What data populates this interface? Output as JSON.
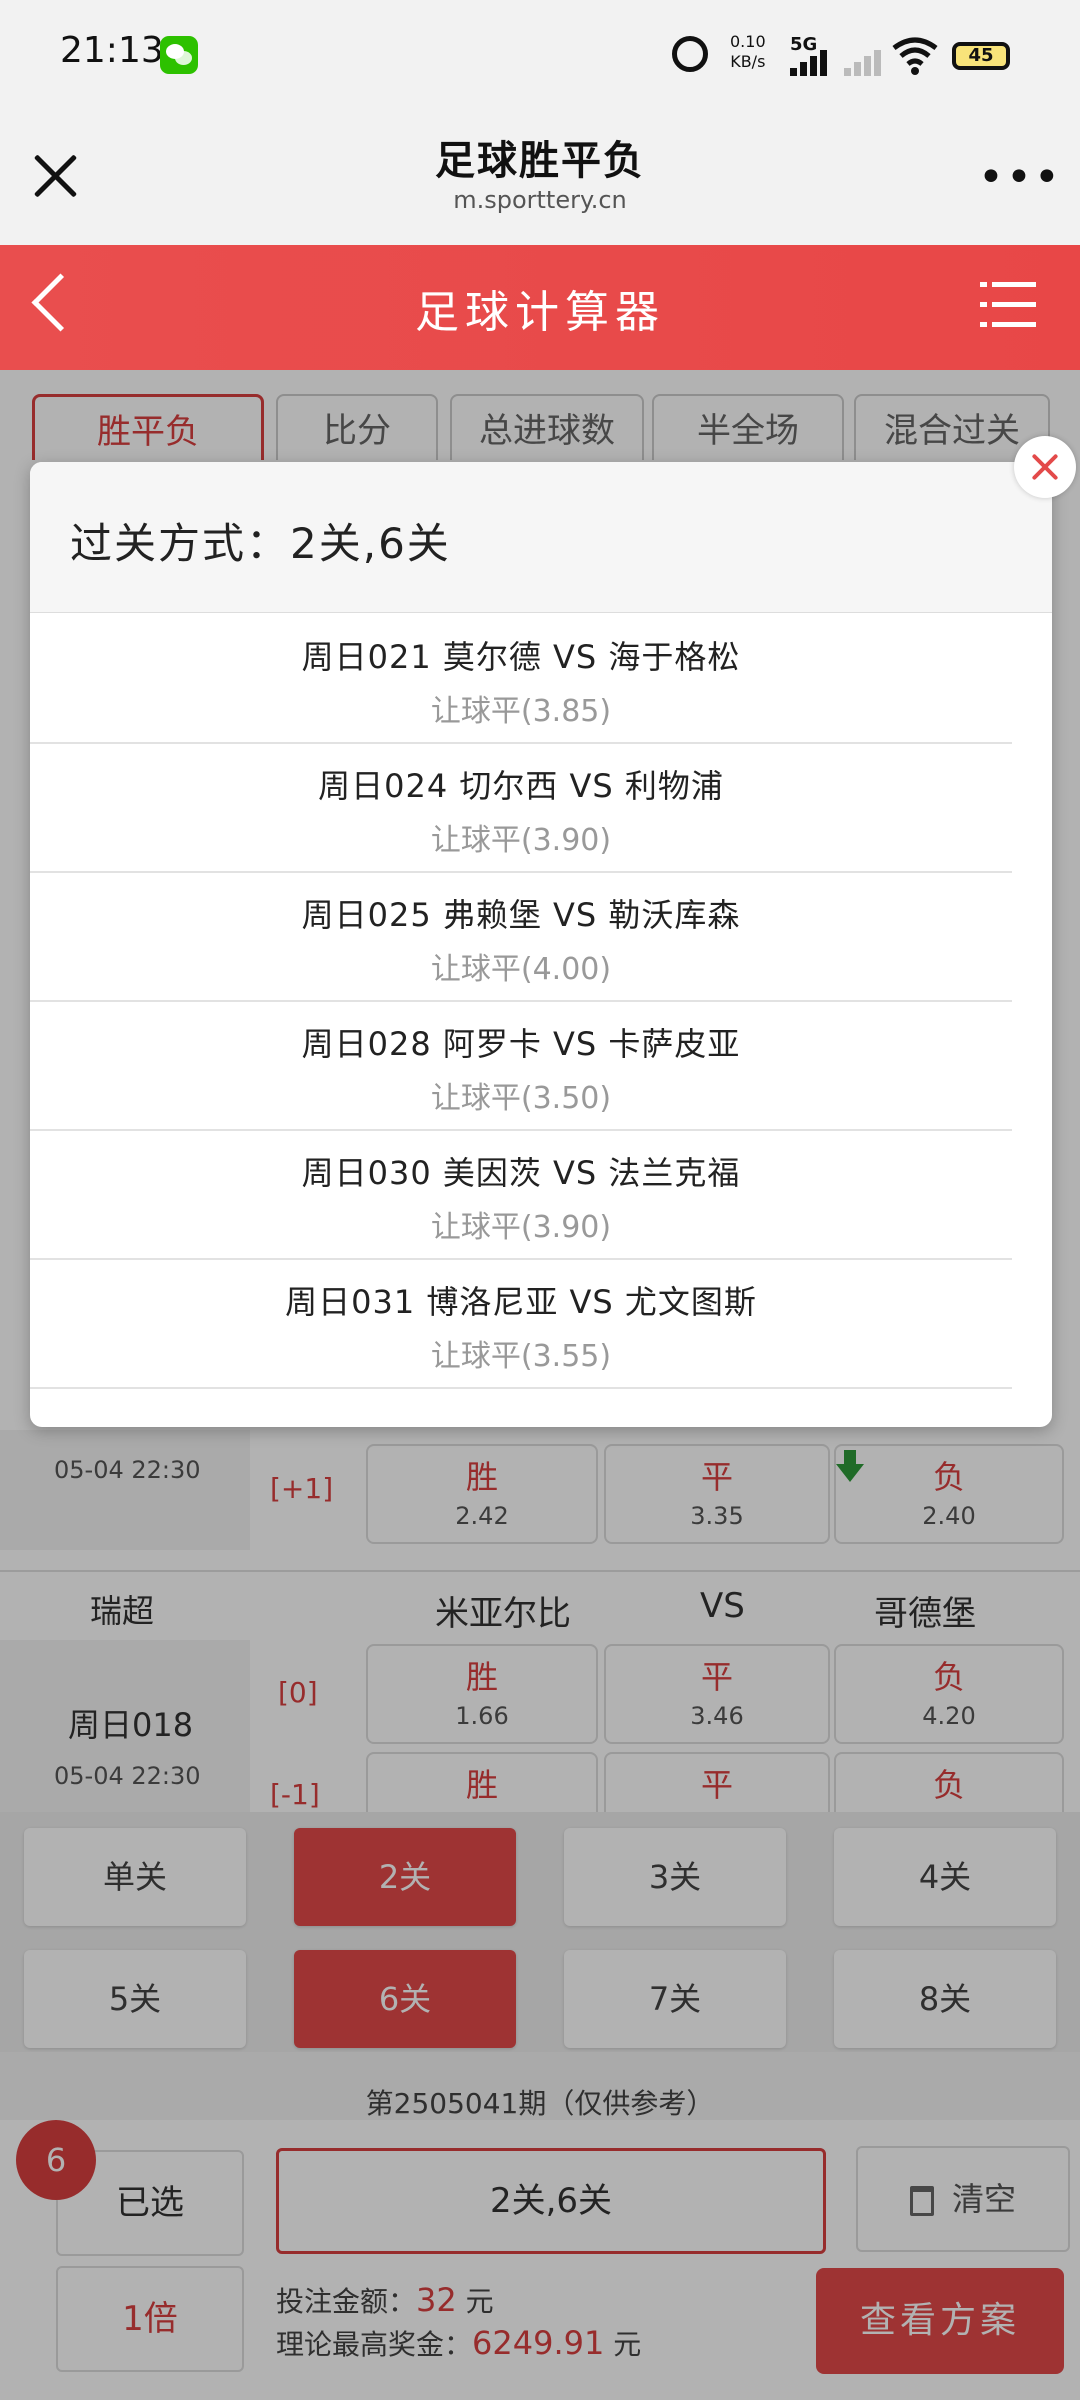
{
  "status_bar": {
    "time": "21:13",
    "network_speed_value": "0.10",
    "network_speed_unit": "KB/s",
    "network_type": "5G",
    "battery": "45"
  },
  "titlebar": {
    "title": "足球胜平负",
    "url": "m.sporttery.cn",
    "more": "•••"
  },
  "red_header": {
    "title": "足球计算器"
  },
  "tabs": [
    {
      "label": "胜平负"
    },
    {
      "label": "比分"
    },
    {
      "label": "总进球数"
    },
    {
      "label": "半全场"
    },
    {
      "label": "混合过关"
    }
  ],
  "background": {
    "match_a": {
      "time": "05-04 22:30",
      "handicap": "[+1]",
      "win_label": "胜",
      "win_odds": "2.42",
      "draw_label": "平",
      "draw_odds": "3.35",
      "lose_label": "负",
      "lose_odds": "2.40"
    },
    "match_b": {
      "league": "瑞超",
      "home": "米亚尔比",
      "vs": "VS",
      "away": "哥德堡",
      "code": "周日018",
      "time": "05-04 22:30",
      "handicap_0": "[0]",
      "handicap_1": "[-1]",
      "win_label": "胜",
      "win_odds": "1.66",
      "draw_label": "平",
      "draw_odds": "3.46",
      "lose_label": "负",
      "lose_odds": "4.20",
      "win_label_2": "胜",
      "draw_label_2": "平",
      "lose_label_2": "负"
    }
  },
  "pass_buttons": [
    {
      "label": "单关",
      "selected": false
    },
    {
      "label": "2关",
      "selected": true
    },
    {
      "label": "3关",
      "selected": false
    },
    {
      "label": "4关",
      "selected": false
    },
    {
      "label": "5关",
      "selected": false
    },
    {
      "label": "6关",
      "selected": true
    },
    {
      "label": "7关",
      "selected": false
    },
    {
      "label": "8关",
      "selected": false
    }
  ],
  "period_text": "第2505041期（仅供参考）",
  "bottom": {
    "selected_count": "6",
    "selected_label": "已选",
    "summary": "2关,6关",
    "clear_label": "清空",
    "multiplier": "1倍",
    "bet_label": "投注金额：",
    "bet_amount": "32",
    "bet_unit": "元",
    "prize_label": "理论最高奖金：",
    "prize_amount": "6249.91",
    "prize_unit": "元",
    "view_plan": "查看方案"
  },
  "modal": {
    "title": "过关方式：2关,6关",
    "matches": [
      {
        "line1": "周日021 莫尔德 VS 海于格松",
        "line2": "让球平(3.85)"
      },
      {
        "line1": "周日024 切尔西 VS 利物浦",
        "line2": "让球平(3.90)"
      },
      {
        "line1": "周日025 弗赖堡 VS 勒沃库森",
        "line2": "让球平(4.00)"
      },
      {
        "line1": "周日028 阿罗卡 VS 卡萨皮亚",
        "line2": "让球平(3.50)"
      },
      {
        "line1": "周日030 美因茨 VS 法兰克福",
        "line2": "让球平(3.90)"
      },
      {
        "line1": "周日031 博洛尼亚 VS 尤文图斯",
        "line2": "让球平(3.55)"
      }
    ]
  },
  "colors": {
    "brand_red": "#e34a4a",
    "background": "#f2f2f2",
    "muted_text": "#999999"
  }
}
